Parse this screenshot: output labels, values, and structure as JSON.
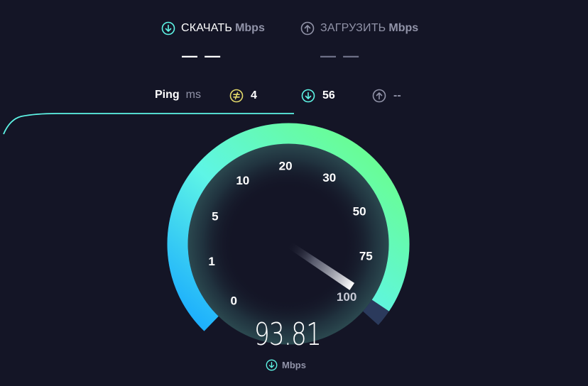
{
  "header": {
    "download": {
      "label": "СКАЧАТЬ",
      "unit": "Mbps",
      "value": "— —",
      "icon": "download-arrow-icon"
    },
    "upload": {
      "label": "ЗАГРУЗИТЬ",
      "unit": "Mbps",
      "value": "— —",
      "icon": "upload-arrow-icon"
    }
  },
  "ping": {
    "label": "Ping",
    "unit": "ms",
    "idle": {
      "value": "4",
      "icon": "idle-latency-icon"
    },
    "download": {
      "value": "56",
      "icon": "download-latency-icon"
    },
    "upload": {
      "value": "--",
      "icon": "upload-latency-icon"
    }
  },
  "gauge": {
    "scale_labels": [
      "0",
      "1",
      "5",
      "10",
      "20",
      "30",
      "50",
      "75",
      "100"
    ],
    "current_speed": "93.81",
    "unit": "Mbps",
    "needle_value": 93.81,
    "colors": {
      "start": "#1ab8ff",
      "mid": "#5ef5e6",
      "end": "#6cff7e",
      "inactive": "#2b3a5c"
    }
  },
  "colors": {
    "background": "#141526",
    "accent": "#5ef5e6",
    "ping_idle": "#e3d96a",
    "muted": "#9193a8"
  }
}
